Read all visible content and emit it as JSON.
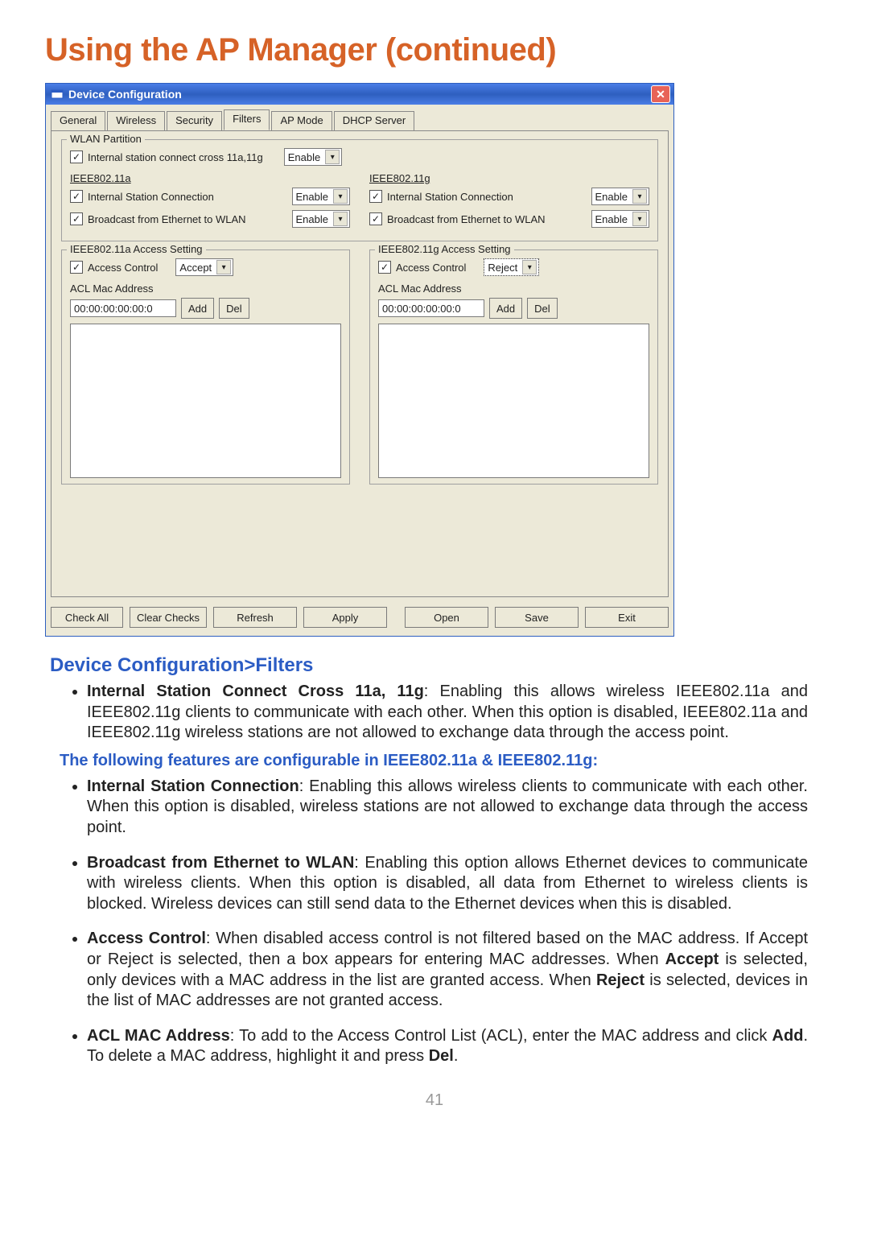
{
  "page": {
    "title": "Using the AP Manager (continued)",
    "number": "41",
    "subhead": "Device Configuration>Filters",
    "note": "The following features are configurable in IEEE802.11a & IEEE802.11g:"
  },
  "dialog": {
    "title": "Device Configuration",
    "tabs": [
      "General",
      "Wireless",
      "Security",
      "Filters",
      "AP Mode",
      "DHCP Server"
    ],
    "active_tab_index": 3,
    "wlan_partition": {
      "legend": "WLAN Partition",
      "cross_label": "Internal station connect cross 11a,11g",
      "cross_select": "Enable",
      "ieee11a": {
        "heading": "IEEE802.11a",
        "isc_label": "Internal Station Connection",
        "isc_select": "Enable",
        "bcast_label": "Broadcast from Ethernet to WLAN",
        "bcast_select": "Enable"
      },
      "ieee11g": {
        "heading": "IEEE802.11g",
        "isc_label": "Internal Station Connection",
        "isc_select": "Enable",
        "bcast_label": "Broadcast from Ethernet to WLAN",
        "bcast_select": "Enable"
      }
    },
    "access11a": {
      "legend": "IEEE802.11a Access Setting",
      "access_label": "Access Control",
      "access_select": "Accept",
      "acl_label": "ACL Mac Address",
      "acl_value": "00:00:00:00:00:0",
      "add": "Add",
      "del": "Del"
    },
    "access11g": {
      "legend": "IEEE802.11g Access Setting",
      "access_label": "Access Control",
      "access_select": "Reject",
      "acl_label": "ACL Mac Address",
      "acl_value": "00:00:00:00:00:0",
      "add": "Add",
      "del": "Del"
    },
    "buttons": {
      "check_all": "Check All",
      "clear": "Clear Checks",
      "refresh": "Refresh",
      "apply": "Apply",
      "open": "Open",
      "save": "Save",
      "exit": "Exit"
    }
  },
  "bullets": {
    "b1_t": "Internal Station Connect Cross 11a, 11g",
    "b1": ": Enabling this allows wireless IEEE802.11a and IEEE802.11g clients to communicate with each other. When this option is disabled, IEEE802.11a and IEEE802.11g wireless stations are not allowed to exchange data through the access point.",
    "b2_t": "Internal Station Connection",
    "b2": ": Enabling this allows wireless clients to communicate with each other. When this option is disabled, wireless stations are not allowed to exchange data through the access point.",
    "b3_t": "Broadcast from Ethernet to WLAN",
    "b3": ": Enabling this option allows Ethernet devices to communicate with wireless clients. When this option is disabled, all data from Ethernet to wireless clients is blocked. Wireless devices can still send data to the Ethernet devices when this is disabled.",
    "b4_t": "Access Control",
    "b4a": ": When disabled access control is not filtered based on  the MAC address. If Accept or Reject is selected, then a box appears for entering MAC addresses. When ",
    "b4b": "Accept",
    "b4c": " is selected, only devices with a MAC address in the list are granted access. When ",
    "b4d": "Reject",
    "b4e": " is selected, devices in the list of MAC addresses are not granted access.",
    "b5_t": "ACL MAC Address",
    "b5a": ": To add to the Access Control List (ACL), enter the MAC address and click ",
    "b5b": "Add",
    "b5c": ". To delete a MAC address, highlight it and press ",
    "b5d": "Del",
    "b5e": "."
  }
}
